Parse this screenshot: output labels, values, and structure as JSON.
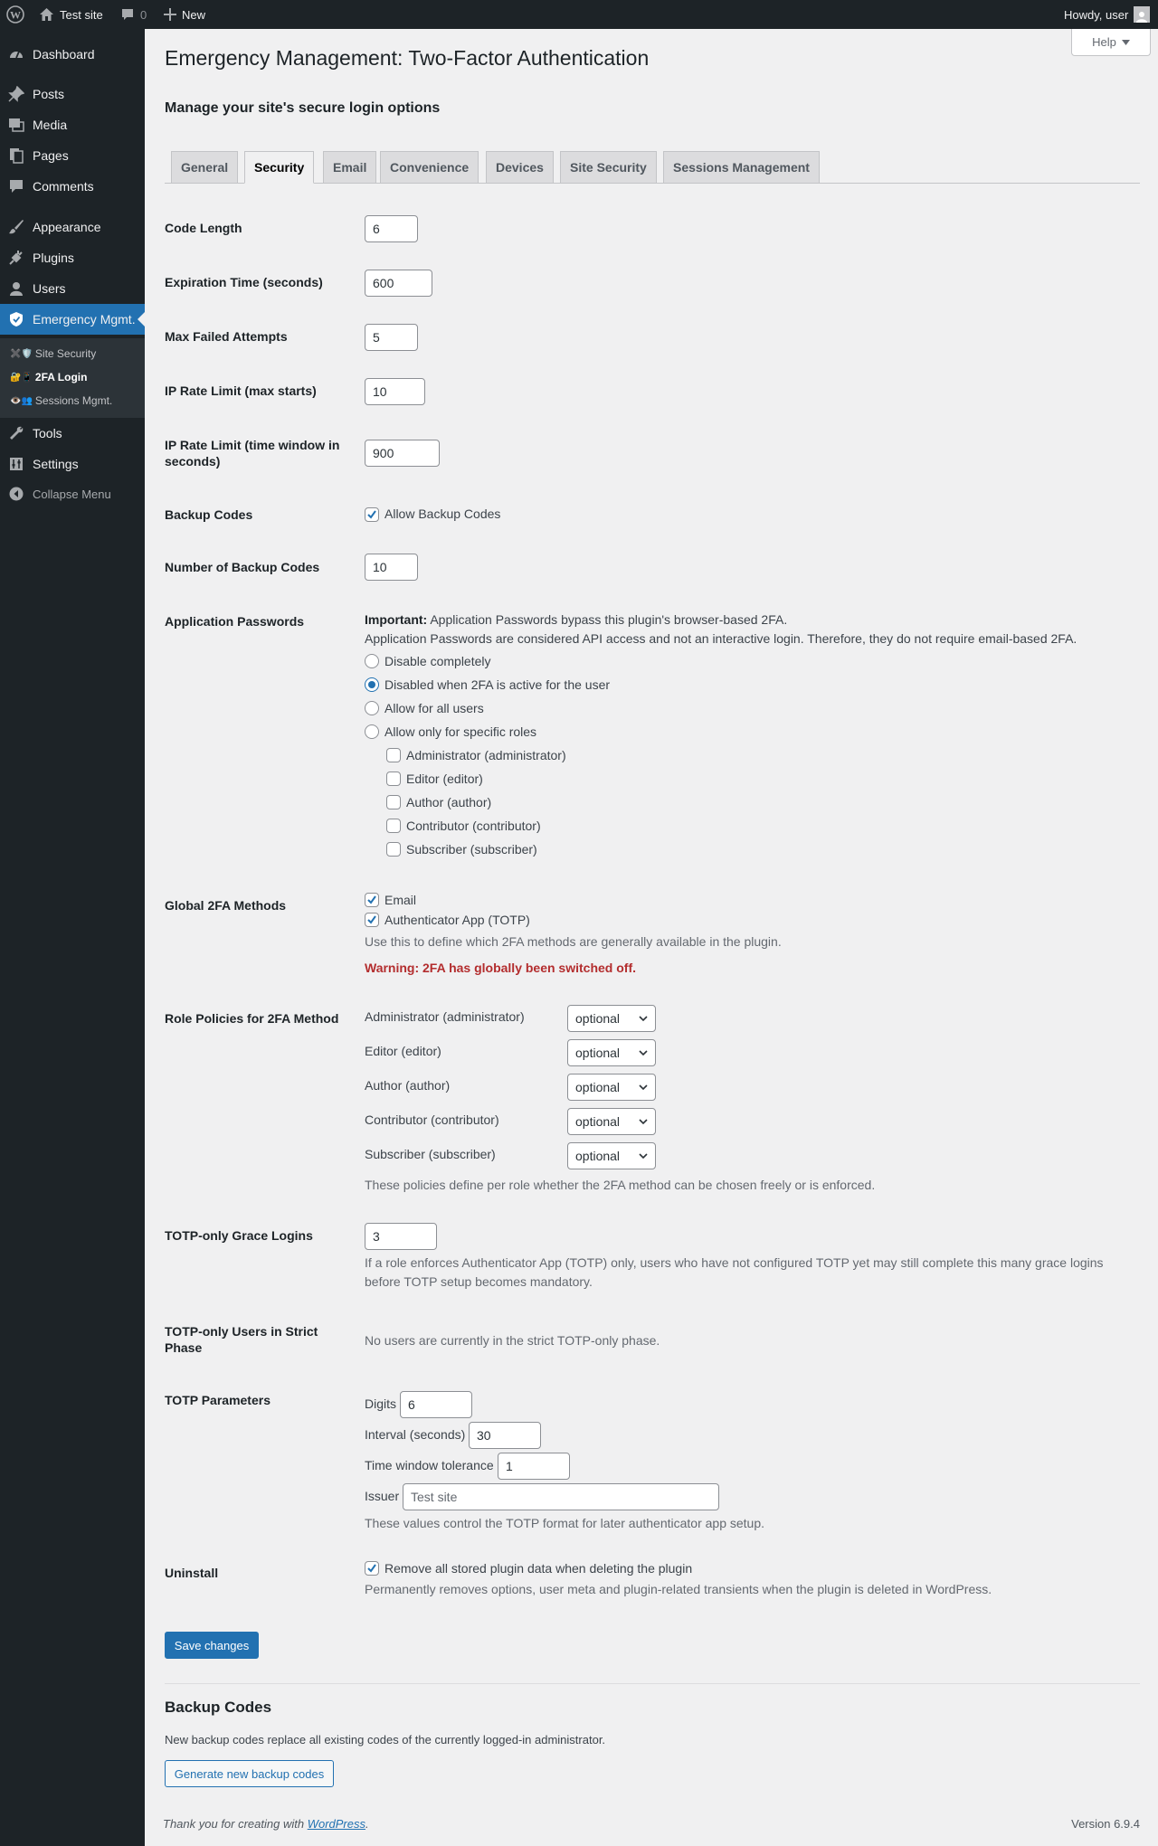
{
  "adminbar": {
    "site_name": "Test site",
    "comments_count": "0",
    "new_label": "New",
    "howdy": "Howdy, user"
  },
  "sidebar": {
    "items": [
      {
        "label": "Dashboard",
        "icon": "dashboard-icon"
      },
      {
        "label": "Posts",
        "icon": "pin-icon"
      },
      {
        "label": "Media",
        "icon": "media-icon"
      },
      {
        "label": "Pages",
        "icon": "pages-icon"
      },
      {
        "label": "Comments",
        "icon": "comments-icon"
      },
      {
        "label": "Appearance",
        "icon": "brush-icon"
      },
      {
        "label": "Plugins",
        "icon": "plug-icon"
      },
      {
        "label": "Users",
        "icon": "user-icon"
      },
      {
        "label": "Emergency Mgmt.",
        "icon": "shield-icon"
      },
      {
        "label": "Tools",
        "icon": "wrench-icon"
      },
      {
        "label": "Settings",
        "icon": "settings-icon"
      }
    ],
    "submenu": [
      {
        "label": "Site Security",
        "icons": "✖️🛡️"
      },
      {
        "label": "2FA Login",
        "icons": "🔐📱"
      },
      {
        "label": "Sessions Mgmt.",
        "icons": "👁️👥"
      }
    ],
    "collapse_label": "Collapse Menu"
  },
  "page": {
    "title": "Emergency Management: Two-Factor Authentication",
    "subtitle": "Manage your site's secure login options",
    "help_label": "Help"
  },
  "tabs": [
    "General",
    "Security",
    "Email",
    "Convenience",
    "Devices",
    "Site Security",
    "Sessions Management"
  ],
  "fields": {
    "code_length": {
      "label": "Code Length",
      "value": "6"
    },
    "expiration": {
      "label": "Expiration Time (seconds)",
      "value": "600"
    },
    "max_failed": {
      "label": "Max Failed Attempts",
      "value": "5"
    },
    "ip_rate_starts": {
      "label": "IP Rate Limit (max starts)",
      "value": "10"
    },
    "ip_rate_window": {
      "label": "IP Rate Limit (time window in seconds)",
      "value": "900"
    },
    "backup_codes": {
      "label": "Backup Codes",
      "checkbox_label": "Allow Backup Codes"
    },
    "num_backup_codes": {
      "label": "Number of Backup Codes",
      "value": "10"
    },
    "app_passwords": {
      "label": "Application Passwords",
      "important_bold": "Important:",
      "important_text": " Application Passwords bypass this plugin's browser-based 2FA.",
      "note": "Application Passwords are considered API access and not an interactive login. Therefore, they do not require email-based 2FA.",
      "options": [
        "Disable completely",
        "Disabled when 2FA is active for the user",
        "Allow for all users",
        "Allow only for specific roles"
      ],
      "roles": [
        "Administrator (administrator)",
        "Editor (editor)",
        "Author (author)",
        "Contributor (contributor)",
        "Subscriber (subscriber)"
      ]
    },
    "global_methods": {
      "label": "Global 2FA Methods",
      "methods": [
        "Email",
        "Authenticator App (TOTP)"
      ],
      "desc": "Use this to define which 2FA methods are generally available in the plugin.",
      "warning": "Warning: 2FA has globally been switched off."
    },
    "role_policies": {
      "label": "Role Policies for 2FA Method",
      "rows": [
        {
          "role": "Administrator (administrator)",
          "value": "optional"
        },
        {
          "role": "Editor (editor)",
          "value": "optional"
        },
        {
          "role": "Author (author)",
          "value": "optional"
        },
        {
          "role": "Contributor (contributor)",
          "value": "optional"
        },
        {
          "role": "Subscriber (subscriber)",
          "value": "optional"
        }
      ],
      "desc": "These policies define per role whether the 2FA method can be chosen freely or is enforced."
    },
    "grace_logins": {
      "label": "TOTP-only Grace Logins",
      "value": "3",
      "desc1": "If a role enforces Authenticator App (TOTP) only, users who have not configured TOTP yet may still complete this many grace logins",
      "desc2": "before TOTP setup becomes mandatory."
    },
    "strict_phase": {
      "label": "TOTP-only Users in Strict Phase",
      "text": "No users are currently in the strict TOTP-only phase."
    },
    "totp_params": {
      "label": "TOTP Parameters",
      "digits_label": "Digits",
      "digits_value": "6",
      "interval_label": "Interval (seconds)",
      "interval_value": "30",
      "tolerance_label": "Time window tolerance",
      "tolerance_value": "1",
      "issuer_label": "Issuer",
      "issuer_placeholder": "Test site",
      "desc": "These values control the TOTP format for later authenticator app setup."
    },
    "uninstall": {
      "label": "Uninstall",
      "checkbox_label": "Remove all stored plugin data when deleting the plugin",
      "desc": "Permanently removes options, user meta and plugin-related transients when the plugin is deleted in WordPress."
    }
  },
  "save_label": "Save changes",
  "backup_section": {
    "title": "Backup Codes",
    "desc": "New backup codes replace all existing codes of the currently logged-in administrator.",
    "button": "Generate new backup codes"
  },
  "footer": {
    "thanks_prefix": "Thank you for creating with ",
    "thanks_link": "WordPress",
    "thanks_suffix": ".",
    "version": "Version 6.9.4"
  },
  "colors": {
    "accent": "#2271b1",
    "sidebar_bg": "#1d2327",
    "warning": "#b32d2e"
  }
}
